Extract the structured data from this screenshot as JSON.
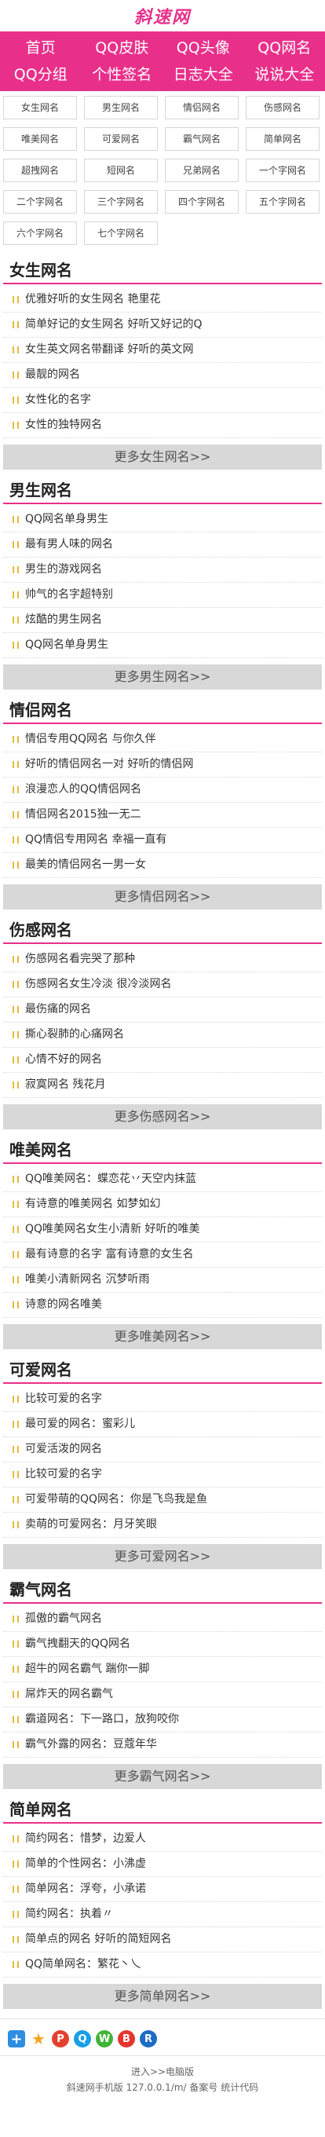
{
  "header": {
    "logo": "斜速网"
  },
  "nav": [
    "首页",
    "QQ皮肤",
    "QQ头像",
    "QQ网名",
    "QQ分组",
    "个性签名",
    "日志大全",
    "说说大全"
  ],
  "tags": [
    "女生网名",
    "男生网名",
    "情侣网名",
    "伤感网名",
    "唯美网名",
    "可爱网名",
    "霸气网名",
    "简单网名",
    "超拽网名",
    "短网名",
    "兄弟网名",
    "一个字网名",
    "二个字网名",
    "三个字网名",
    "四个字网名",
    "五个字网名",
    "六个字网名",
    "七个字网名"
  ],
  "sections": [
    {
      "title": "女生网名",
      "items": [
        "优雅好听的女生网名 艳里花",
        "简单好记的女生网名 好听又好记的Q",
        "女生英文网名带翻译 好听的英文网",
        "最靓的网名",
        "女性化的名字",
        "女性的独特网名"
      ],
      "more": "更多女生网名>>"
    },
    {
      "title": "男生网名",
      "items": [
        "QQ网名单身男生",
        "最有男人味的网名",
        "男生的游戏网名",
        "帅气的名字超特别",
        "炫酷的男生网名",
        "QQ网名单身男生"
      ],
      "more": "更多男生网名>>"
    },
    {
      "title": "情侣网名",
      "items": [
        "情侣专用QQ网名 与你久伴",
        "好听的情侣网名一对 好听的情侣网",
        "浪漫恋人的QQ情侣网名",
        "情侣网名2015独一无二",
        "QQ情侣专用网名 幸福一直有",
        "最美的情侣网名一男一女"
      ],
      "more": "更多情侣网名>>"
    },
    {
      "title": "伤感网名",
      "items": [
        "伤感网名看完哭了那种",
        "伤感网名女生冷淡 很冷淡网名",
        "最伤痛的网名",
        "撕心裂肺的心痛网名",
        "心情不好的网名",
        "寂寞网名 残花月"
      ],
      "more": "更多伤感网名>>"
    },
    {
      "title": "唯美网名",
      "items": [
        "QQ唯美网名：蝶恋花丷天空内抹蓝",
        "有诗意的唯美网名 如梦如幻",
        "QQ唯美网名女生小清新 好听的唯美",
        "最有诗意的名字 富有诗意的女生名",
        "唯美小清新网名 沉梦听雨",
        "诗意的网名唯美"
      ],
      "more": "更多唯美网名>>"
    },
    {
      "title": "可爱网名",
      "items": [
        "比较可爱的名字",
        "最可爱的网名：蜜彩儿",
        "可爱活泼的网名",
        "比较可爱的名字",
        "可爱带萌的QQ网名：你是飞鸟我是鱼",
        "卖萌的可爱网名：月牙笑眼"
      ],
      "more": "更多可爱网名>>"
    },
    {
      "title": "霸气网名",
      "items": [
        "孤傲的霸气网名",
        "霸气拽翻天的QQ网名",
        "超牛的网名霸气 踹你一脚",
        "屌炸天的网名霸气",
        "霸道网名：下一路口，放狗咬你",
        "霸气外露的网名：豆蔻年华"
      ],
      "more": "更多霸气网名>>"
    },
    {
      "title": "简单网名",
      "items": [
        "简约网名：惜梦，边爱人",
        "简单的个性网名：小沸虚",
        "简单网名：浮夸，小承诺",
        "简约网名：执着〃",
        "简单点的网名 好听的简短网名",
        "QQ简单网名：繁花丶乀"
      ],
      "more": "更多简单网名>>"
    }
  ],
  "share_icons": [
    "plus-icon",
    "star-icon",
    "pinterest-icon",
    "qq-icon",
    "wechat-icon",
    "weibo-icon",
    "renren-icon"
  ],
  "footer": {
    "line1": "进入>>电脑版",
    "line2": "斜速网手机版 127.0.0.1/m/ 备案号 统计代码"
  },
  "colors": {
    "accent": "#e8308a",
    "bullet": "#e6b93c",
    "more_bg": "#d8d8d8"
  }
}
